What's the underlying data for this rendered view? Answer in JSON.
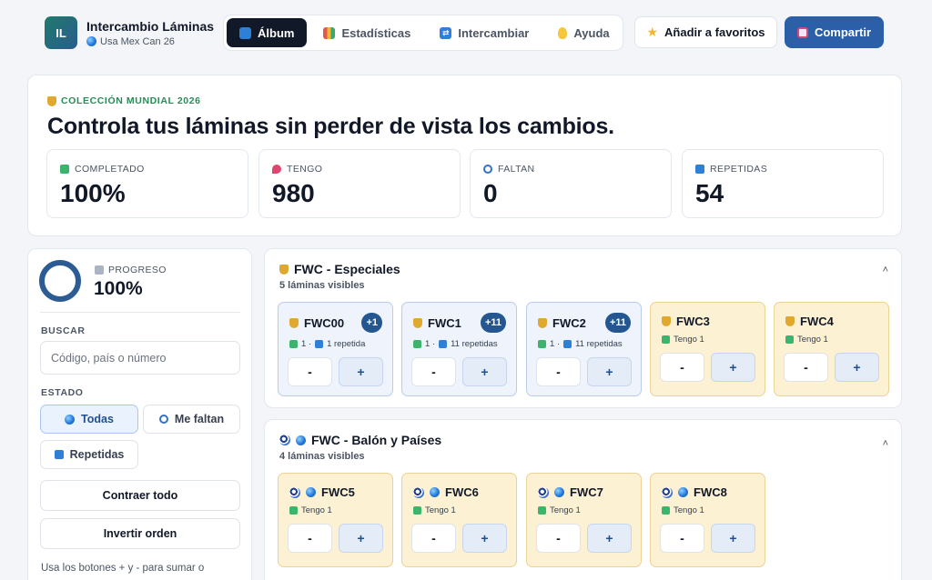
{
  "brand": {
    "initials": "IL",
    "title": "Intercambio Láminas",
    "subtitle": "Usa Mex Can 26"
  },
  "nav": {
    "tabs": [
      {
        "label": "Álbum",
        "icon": "book-icon",
        "active": true
      },
      {
        "label": "Estadísticas",
        "icon": "chart-icon",
        "active": false
      },
      {
        "label": "Intercambiar",
        "icon": "swap-icon",
        "active": false
      },
      {
        "label": "Ayuda",
        "icon": "bulb-icon",
        "active": false
      }
    ]
  },
  "actions": {
    "favorite_label": "Añadir a favoritos",
    "share_label": "Compartir"
  },
  "hero": {
    "eyebrow": "COLECCIÓN MUNDIAL 2026",
    "title": "Controla tus láminas sin perder de vista los cambios.",
    "stats": [
      {
        "label": "COMPLETADO",
        "value": "100%"
      },
      {
        "label": "TENGO",
        "value": "980"
      },
      {
        "label": "FALTAN",
        "value": "0"
      },
      {
        "label": "REPETIDAS",
        "value": "54"
      }
    ]
  },
  "sidebar": {
    "progress_label": "PROGRESO",
    "progress_value": "100%",
    "progress_fraction": 1.0,
    "search_label": "BUSCAR",
    "search_placeholder": "Código, país o número",
    "filter_label": "ESTADO",
    "filters": [
      {
        "label": "Todas",
        "active": true
      },
      {
        "label": "Me faltan",
        "active": false
      },
      {
        "label": "Repetidas",
        "active": false
      }
    ],
    "collapse_label": "Contraer todo",
    "invert_label": "Invertir orden",
    "help_text": "Usa los botones + y - para sumar o"
  },
  "sections": [
    {
      "title": "FWC - Especiales",
      "subtitle": "5 láminas visibles",
      "cards": [
        {
          "code": "FWC00",
          "badge": "+1",
          "status": "1 ·",
          "repeat": "1 repetida",
          "minus": "-",
          "plus": "+"
        },
        {
          "code": "FWC1",
          "badge": "+11",
          "status": "1 ·",
          "repeat": "11 repetidas",
          "minus": "-",
          "plus": "+"
        },
        {
          "code": "FWC2",
          "badge": "+11",
          "status": "1 ·",
          "repeat": "11 repetidas",
          "minus": "-",
          "plus": "+"
        },
        {
          "code": "FWC3",
          "status": "Tengo 1",
          "minus": "-",
          "plus": "+"
        },
        {
          "code": "FWC4",
          "status": "Tengo 1",
          "minus": "-",
          "plus": "+"
        }
      ]
    },
    {
      "title": "FWC - Balón y Países",
      "subtitle": "4 láminas visibles",
      "cards": [
        {
          "code": "FWC5",
          "status": "Tengo 1",
          "minus": "-",
          "plus": "+"
        },
        {
          "code": "FWC6",
          "status": "Tengo 1",
          "minus": "-",
          "plus": "+"
        },
        {
          "code": "FWC7",
          "status": "Tengo 1",
          "minus": "-",
          "plus": "+"
        },
        {
          "code": "FWC8",
          "status": "Tengo 1",
          "minus": "-",
          "plus": "+"
        }
      ]
    }
  ],
  "colors": {
    "accent": "#2b5fa8",
    "dark": "#111827",
    "repeat_card": "#eef3fc",
    "owned_card": "#fdf1d4",
    "badge": "#24578f",
    "eyebrow": "#2a8a57"
  }
}
